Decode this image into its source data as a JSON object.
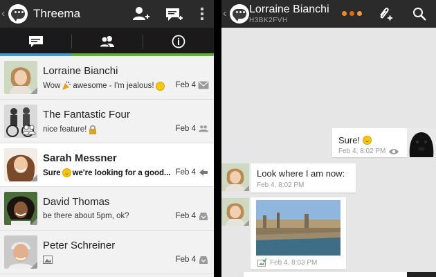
{
  "left": {
    "app_title": "Threema",
    "tabs": [
      {
        "icon": "chat-icon"
      },
      {
        "icon": "contacts-icon"
      },
      {
        "icon": "info-icon"
      }
    ],
    "conversations": [
      {
        "name": "Lorraine Bianchi",
        "snippet_before": "Wow",
        "snippet_mid": "awesome - I'm jealous!",
        "date": "Feb 4",
        "state_icon": "envelope-icon",
        "unread": false
      },
      {
        "name": "The Fantastic Four",
        "snippet_before": "nice feature!",
        "date": "Feb 4",
        "state_icon": "group-icon",
        "unread": false
      },
      {
        "name": "Sarah Messner",
        "snippet_before": "Sure",
        "snippet_mid": "we're looking for a good...",
        "date": "Feb 4",
        "state_icon": "reply-arrow-icon",
        "unread": true
      },
      {
        "name": "David Thomas",
        "snippet_before": "be there about 5pm, ok?",
        "date": "Feb 4",
        "state_icon": "inbox-icon",
        "unread": false
      },
      {
        "name": "Peter Schreiner",
        "snippet_before": "",
        "date": "Feb 4",
        "state_icon": "inbox-icon",
        "unread": false
      }
    ]
  },
  "right": {
    "contact_name": "Lorraine Bianchi",
    "contact_id": "H3BK2FVH",
    "messages": [
      {
        "direction": "out",
        "text": "Sure!",
        "meta": "Feb 4, 8:02 PM"
      },
      {
        "direction": "in",
        "text": "Look where I am now:",
        "meta": "Feb 4, 8:02 PM"
      },
      {
        "direction": "in",
        "type": "image",
        "meta": "Feb 4, 8:03 PM"
      }
    ]
  },
  "colors": {
    "bar": "#2b2b2b",
    "tab_accent_green": "#5fb32e",
    "tab_selected_blue": "#3f9ad6",
    "status_orange": "#f08a24"
  }
}
